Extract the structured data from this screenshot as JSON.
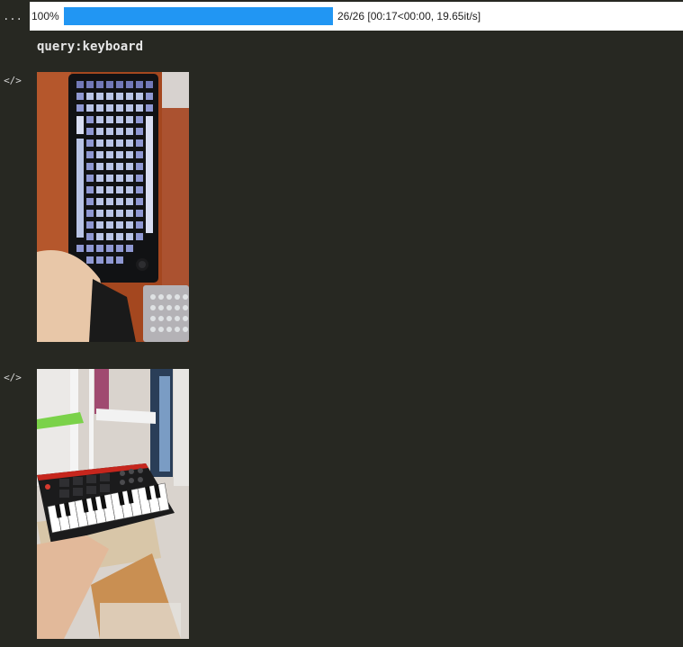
{
  "gutter": {
    "more_glyph": "...",
    "code_glyph": "</>"
  },
  "progress": {
    "percent_text": "100%",
    "value": 1.0,
    "status_text": "26/26 [00:17<00:00, 19.65it/s]",
    "fill_color": "#2196f3"
  },
  "output": {
    "query_text": "query:keyboard"
  },
  "images": [
    {
      "subject": "computer-keyboard-photo"
    },
    {
      "subject": "midi-keyboard-photo"
    }
  ],
  "colors": {
    "background": "#272822",
    "progress_background": "#ffffff",
    "text_light": "#e6e6e6",
    "text_dark": "#1e1e1e"
  }
}
